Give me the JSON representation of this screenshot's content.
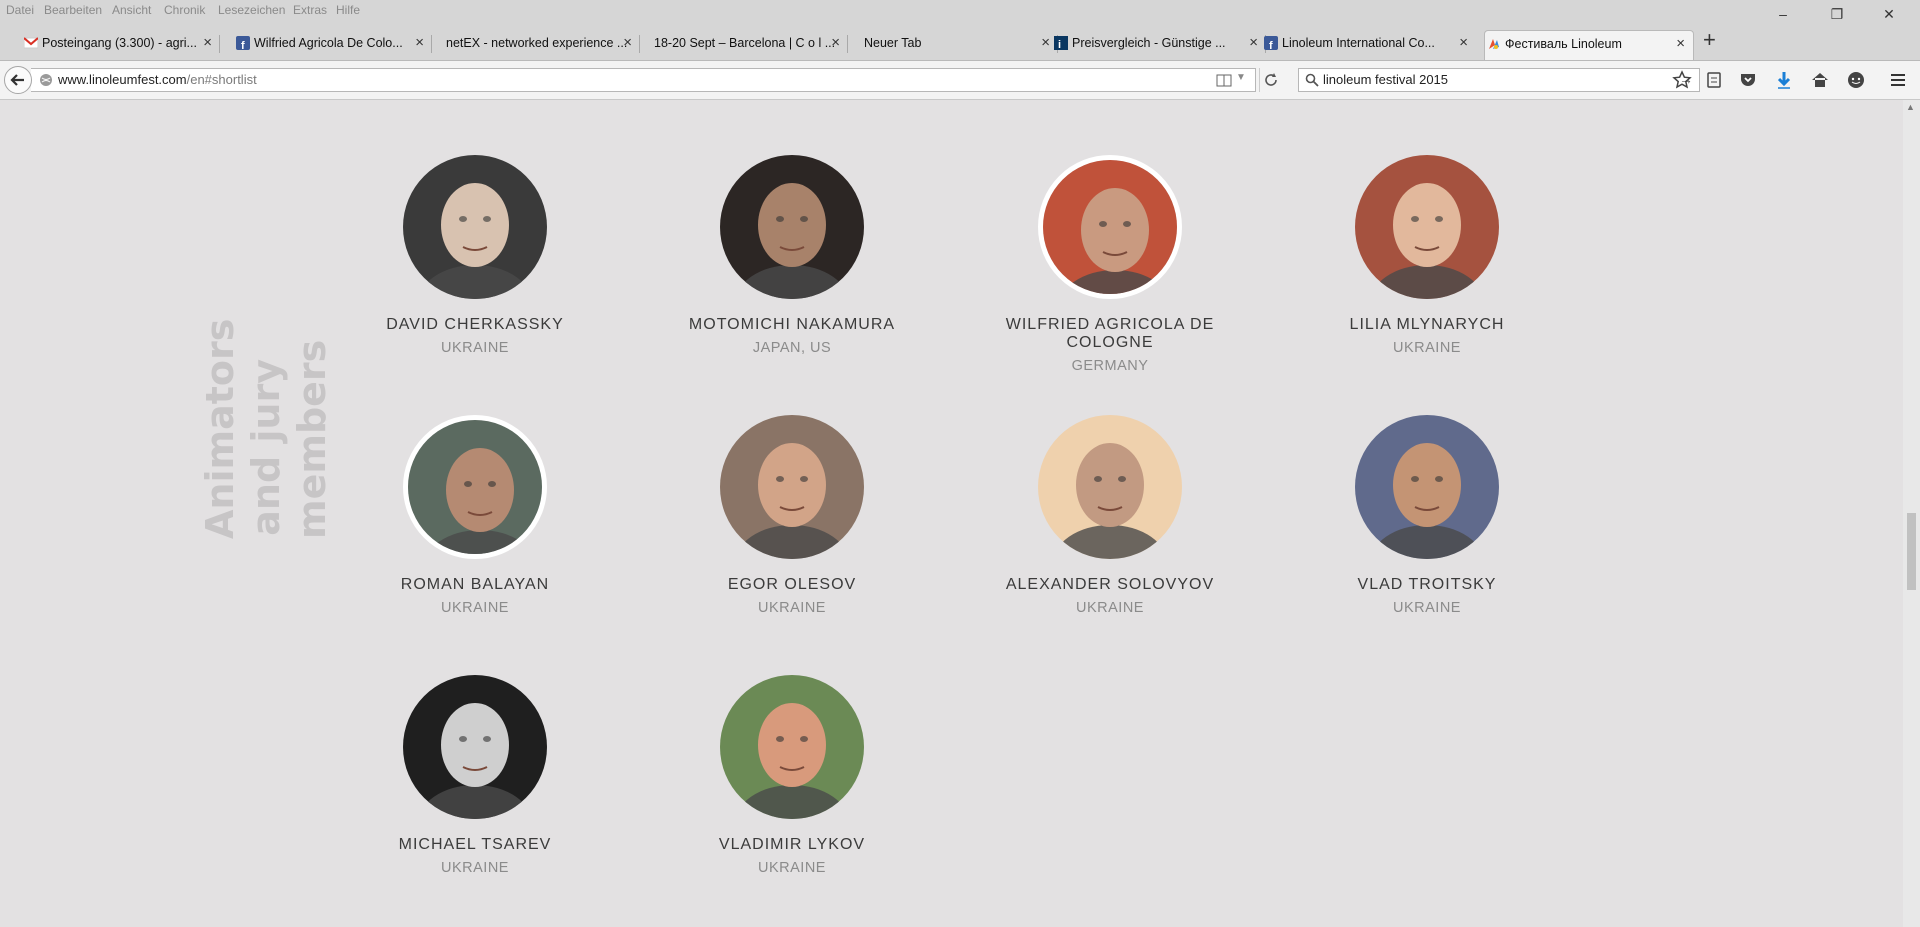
{
  "menu": [
    "Datei",
    "Bearbeiten",
    "Ansicht",
    "Chronik",
    "Lesezeichen",
    "Extras",
    "Hilfe"
  ],
  "tabs": [
    {
      "title": "Posteingang (3.300) - agri...",
      "icon": "gmail-icon"
    },
    {
      "title": "Wilfried Agricola De Colo...",
      "icon": "facebook-icon"
    },
    {
      "title": "netEX - networked experience ...",
      "icon": "none"
    },
    {
      "title": "18-20 Sept – Barcelona | C o l ...",
      "icon": "none"
    },
    {
      "title": "Neuer Tab",
      "icon": "none"
    },
    {
      "title": "Preisvergleich - Günstige ...",
      "icon": "idealo-icon"
    },
    {
      "title": "Linoleum International Co...",
      "icon": "facebook-icon"
    },
    {
      "title": "Фестиваль Linoleum",
      "icon": "linoleum-icon",
      "active": true
    }
  ],
  "url": {
    "host": "www.linoleumfest.com",
    "path": "/en#shortlist"
  },
  "search": {
    "value": "linoleum festival 2015"
  },
  "section": {
    "title_line1": "Animators",
    "title_line2": "and jury",
    "title_line3": "members"
  },
  "people": [
    {
      "name": "DAVID CHERKASSKY",
      "country": "UKRAINE",
      "bg": "#3a3a3a",
      "skin": "#d8c2b0"
    },
    {
      "name": "MOTOMICHI NAKAMURA",
      "country": "JAPAN, US",
      "bg": "#2c2624",
      "skin": "#a8826a"
    },
    {
      "name": "WILFRIED AGRICOLA DE COLOGNE",
      "country": "GERMANY",
      "bg": "#c0523a",
      "skin": "#c99a80"
    },
    {
      "name": "LILIA MLYNARYCH",
      "country": "UKRAINE",
      "bg": "#a5523f",
      "skin": "#e2b89c"
    },
    {
      "name": "ROMAN BALAYAN",
      "country": "UKRAINE",
      "bg": "#5b6a60",
      "skin": "#b58a72"
    },
    {
      "name": "EGOR OLESOV",
      "country": "UKRAINE",
      "bg": "#8a7466",
      "skin": "#d2a488"
    },
    {
      "name": "ALEXANDER SOLOVYOV",
      "country": "UKRAINE",
      "bg": "#efd1ad",
      "skin": "#c29a82"
    },
    {
      "name": "VLAD TROITSKY",
      "country": "UKRAINE",
      "bg": "#606a8c",
      "skin": "#c49474"
    },
    {
      "name": "MICHAEL TSAREV",
      "country": "UKRAINE",
      "bg": "#1f1f1f",
      "skin": "#cfcfcf"
    },
    {
      "name": "VLADIMIR LYKOV",
      "country": "UKRAINE",
      "bg": "#6b8a55",
      "skin": "#d89a7c"
    }
  ]
}
